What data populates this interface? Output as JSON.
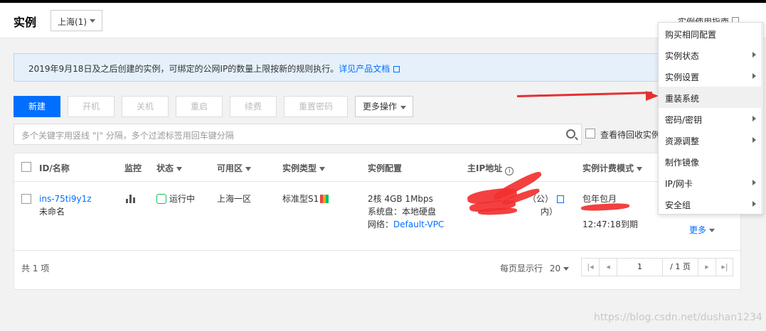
{
  "header": {
    "title": "实例",
    "region": "上海(1)",
    "guide": "实例使用指南"
  },
  "notice": {
    "text": "2019年9月18日及之后创建的实例，可绑定的公网IP的数量上限按新的规则执行。",
    "link": "详见产品文档"
  },
  "toolbar": {
    "new": "新建",
    "start": "开机",
    "stop": "关机",
    "restart": "重启",
    "renew": "续费",
    "reset_password": "重置密码",
    "more": "更多操作"
  },
  "search": {
    "placeholder": "多个关键字用竖线 \"|\" 分隔，多个过滤标签用回车键分隔",
    "pending_label": "查看待回收实例"
  },
  "table": {
    "columns": {
      "id": "ID/名称",
      "monitor": "监控",
      "status": "状态",
      "zone": "可用区",
      "type": "实例类型",
      "config": "实例配置",
      "ip": "主IP地址",
      "billing": "实例计费模式"
    },
    "row": {
      "id": "ins-75ti9y1z",
      "name": "未命名",
      "status": "运行中",
      "zone": "上海一区",
      "type": "标准型S1",
      "config_line1": "2核 4GB 1Mbps",
      "config_line2": "系统盘：本地硬盘",
      "config_line3_label": "网络：",
      "config_line3_link": "Default-VPC",
      "ip_public": "（公）",
      "ip_private": "内）",
      "billing_mode": "包年包月",
      "expire": "12:47:18到期",
      "more": "更多"
    },
    "footer": {
      "total": "共 1 项",
      "per_page_label": "每页显示行",
      "per_page_value": "20",
      "page_value": "1",
      "page_total": "/ 1 页"
    }
  },
  "menu": {
    "items": [
      {
        "label": "购买相同配置",
        "submenu": false
      },
      {
        "label": "实例状态",
        "submenu": true
      },
      {
        "label": "实例设置",
        "submenu": true
      },
      {
        "label": "重装系统",
        "submenu": false
      },
      {
        "label": "密码/密钥",
        "submenu": true
      },
      {
        "label": "资源调整",
        "submenu": true
      },
      {
        "label": "制作镜像",
        "submenu": false
      },
      {
        "label": "IP/网卡",
        "submenu": true
      },
      {
        "label": "安全组",
        "submenu": true
      }
    ]
  },
  "watermark": "https://blog.csdn.net/dushan1234",
  "colors": {
    "primary": "#006eff",
    "success": "#0abf5b",
    "annotation": "#e53030"
  }
}
